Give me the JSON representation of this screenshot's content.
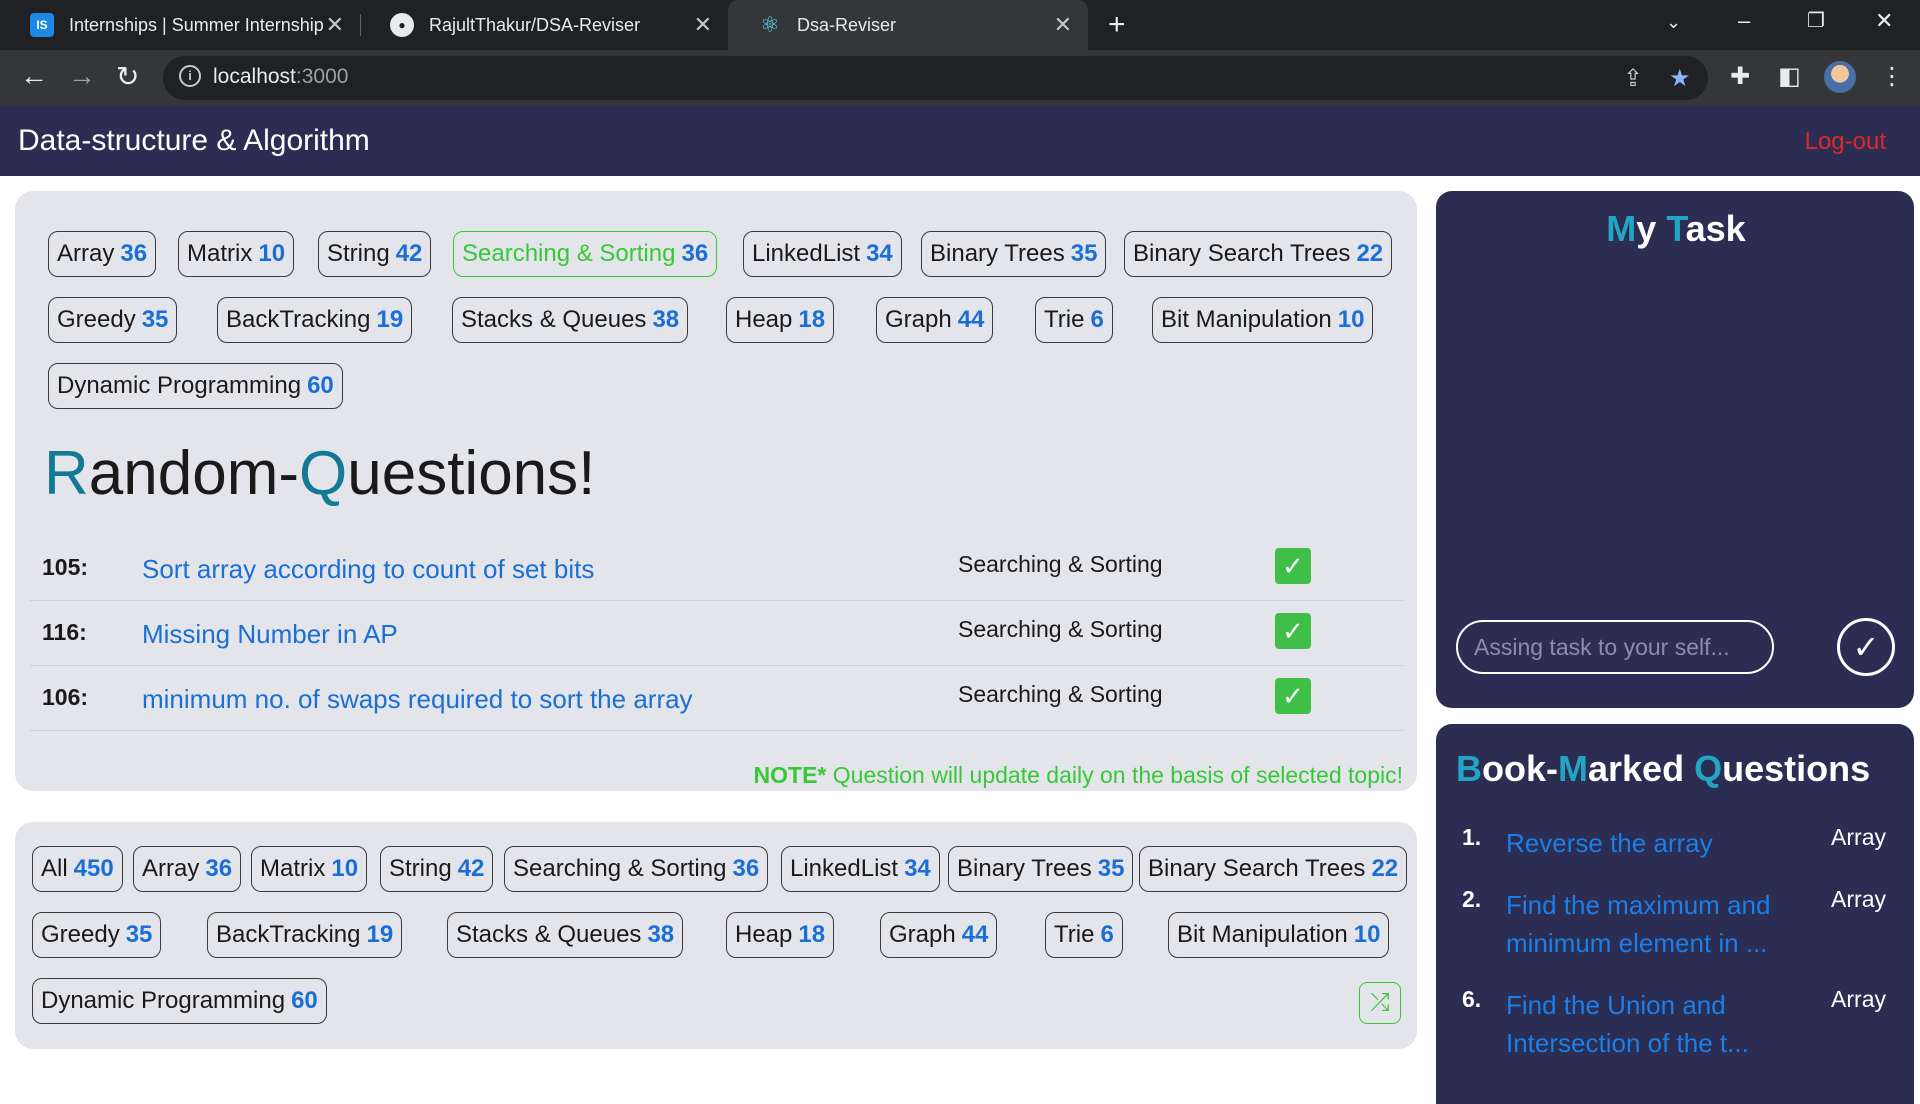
{
  "browser": {
    "tabs": [
      {
        "favicon": "IS",
        "title": "Internships | Summer Internship ..."
      },
      {
        "favicon": "github-icon",
        "title": "RajultThakur/DSA-Reviser"
      },
      {
        "favicon": "react-icon",
        "title": "Dsa-Reviser"
      }
    ],
    "url_host": "localhost",
    "url_port": ":3000"
  },
  "header": {
    "brand": "Data-structure & Algorithm",
    "logout": "Log-out"
  },
  "topic_filter": {
    "selected": "Searching & Sorting",
    "chips": [
      {
        "label": "Array",
        "count": "36"
      },
      {
        "label": "Matrix",
        "count": "10"
      },
      {
        "label": "String",
        "count": "42"
      },
      {
        "label": "Searching & Sorting",
        "count": "36"
      },
      {
        "label": "LinkedList",
        "count": "34"
      },
      {
        "label": "Binary Trees",
        "count": "35"
      },
      {
        "label": "Binary Search Trees",
        "count": "22"
      },
      {
        "label": "Greedy",
        "count": "35"
      },
      {
        "label": "BackTracking",
        "count": "19"
      },
      {
        "label": "Stacks & Queues",
        "count": "38"
      },
      {
        "label": "Heap",
        "count": "18"
      },
      {
        "label": "Graph",
        "count": "44"
      },
      {
        "label": "Trie",
        "count": "6"
      },
      {
        "label": "Bit Manipulation",
        "count": "10"
      },
      {
        "label": "Dynamic Programming",
        "count": "60"
      }
    ]
  },
  "random_questions": {
    "title_first_letter_1": "R",
    "title_rest_1": "andom-",
    "title_first_letter_2": "Q",
    "title_rest_2": "uestions!",
    "rows": [
      {
        "num": "105:",
        "question": "Sort array according to count of set bits",
        "topic": "Searching & Sorting",
        "done": "✓"
      },
      {
        "num": "116:",
        "question": "Missing Number in AP",
        "topic": "Searching & Sorting",
        "done": "✓"
      },
      {
        "num": "106:",
        "question": "minimum no. of swaps required to sort the array",
        "topic": "Searching & Sorting",
        "done": "✓"
      }
    ],
    "note_bold": "NOTE*",
    "note_text": " Question will update daily on the basis of selected topic!"
  },
  "all_topics": {
    "chips": [
      {
        "label": "All",
        "count": "450"
      },
      {
        "label": "Array",
        "count": "36"
      },
      {
        "label": "Matrix",
        "count": "10"
      },
      {
        "label": "String",
        "count": "42"
      },
      {
        "label": "Searching & Sorting",
        "count": "36"
      },
      {
        "label": "LinkedList",
        "count": "34"
      },
      {
        "label": "Binary Trees",
        "count": "35"
      },
      {
        "label": "Binary Search Trees",
        "count": "22"
      },
      {
        "label": "Greedy",
        "count": "35"
      },
      {
        "label": "BackTracking",
        "count": "19"
      },
      {
        "label": "Stacks & Queues",
        "count": "38"
      },
      {
        "label": "Heap",
        "count": "18"
      },
      {
        "label": "Graph",
        "count": "44"
      },
      {
        "label": "Trie",
        "count": "6"
      },
      {
        "label": "Bit Manipulation",
        "count": "10"
      },
      {
        "label": "Dynamic Programming",
        "count": "60"
      }
    ],
    "shuffle_icon": "shuffle-icon"
  },
  "my_task": {
    "title_a": "M",
    "title_b": "y ",
    "title_c": "T",
    "title_d": "ask",
    "input_placeholder": "Assing task to your self...",
    "input_value": ""
  },
  "bookmarks": {
    "title_a": "B",
    "title_b": "ook-",
    "title_c": "M",
    "title_d": "arked ",
    "title_e": "Q",
    "title_f": "uestions",
    "items": [
      {
        "num": "1.",
        "question": "Reverse the array",
        "topic": "Array"
      },
      {
        "num": "2.",
        "question": "Find the maximum and minimum element in ...",
        "topic": "Array"
      },
      {
        "num": "6.",
        "question": "Find the Union and Intersection of the t...",
        "topic": "Array"
      }
    ]
  },
  "colors": {
    "header_bg": "#2b2d52",
    "accent_blue": "#1a6fd6",
    "accent_teal": "#137a96",
    "success_green": "#37c837",
    "logout_red": "#e02828"
  }
}
